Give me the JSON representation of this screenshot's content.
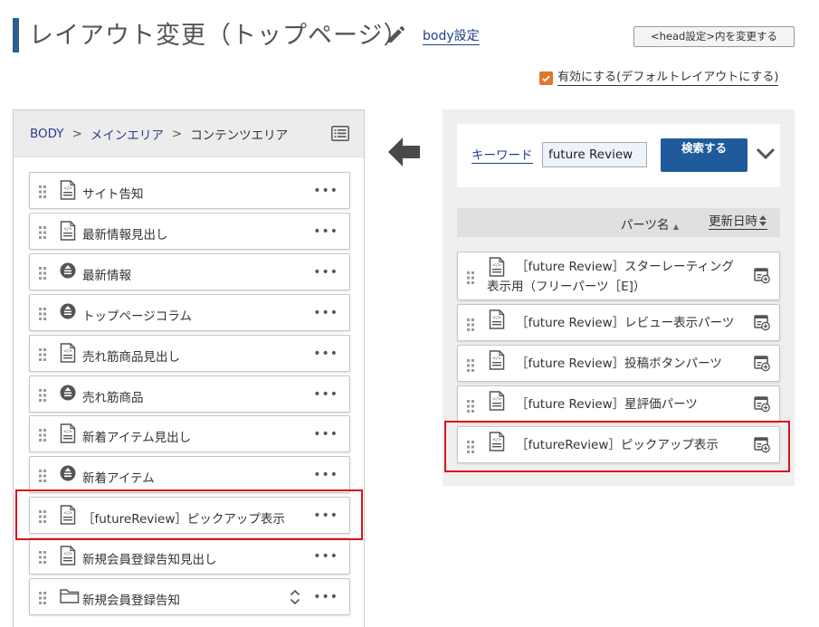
{
  "header": {
    "title": "レイアウト変更（トップページ）",
    "body_settings_link": "body設定",
    "head_settings_button": "<head設定>内を変更する",
    "enable_label": "有効にする(デフォルトレイアウトにする)",
    "enable_checked": true
  },
  "breadcrumb": {
    "items": [
      "BODY",
      "メインエリア",
      "コンテンツエリア"
    ],
    "separator": ">"
  },
  "layout_parts": [
    {
      "label": "サイト告知",
      "icon": "html-file-icon"
    },
    {
      "label": "最新情報見出し",
      "icon": "html-file-icon"
    },
    {
      "label": "最新情報",
      "icon": "component-circle-icon"
    },
    {
      "label": "トップページコラム",
      "icon": "component-circle-icon"
    },
    {
      "label": "売れ筋商品見出し",
      "icon": "html-file-icon"
    },
    {
      "label": "売れ筋商品",
      "icon": "component-circle-icon"
    },
    {
      "label": "新着アイテム見出し",
      "icon": "html-file-icon"
    },
    {
      "label": "新着アイテム",
      "icon": "component-circle-icon"
    },
    {
      "label": "［futureReview］ピックアップ表示",
      "icon": "html-file-icon"
    },
    {
      "label": "新規会員登録告知見出し",
      "icon": "html-file-icon"
    },
    {
      "label": "新規会員登録告知",
      "icon": "folder-icon"
    }
  ],
  "more_label": "•••",
  "search": {
    "keyword_label": "キーワード",
    "keyword_value": "future Review",
    "button_label": "検索する"
  },
  "sort": {
    "name_label": "パーツ名",
    "date_label": "更新日時"
  },
  "search_results": [
    {
      "label": "［future Review］スターレーティング表示用（フリーパーツ［E]）"
    },
    {
      "label": "［future Review］レビュー表示パーツ"
    },
    {
      "label": "［future Review］投稿ボタンパーツ"
    },
    {
      "label": "［future Review］星評価パーツ"
    },
    {
      "label": "［futureReview］ピックアップ表示"
    }
  ],
  "colors": {
    "accent_bar": "#2c5f8a",
    "link": "#1d3f8a",
    "search_button": "#1e5a9c",
    "checkbox": "#e1762d",
    "highlight": "#d9141b"
  }
}
